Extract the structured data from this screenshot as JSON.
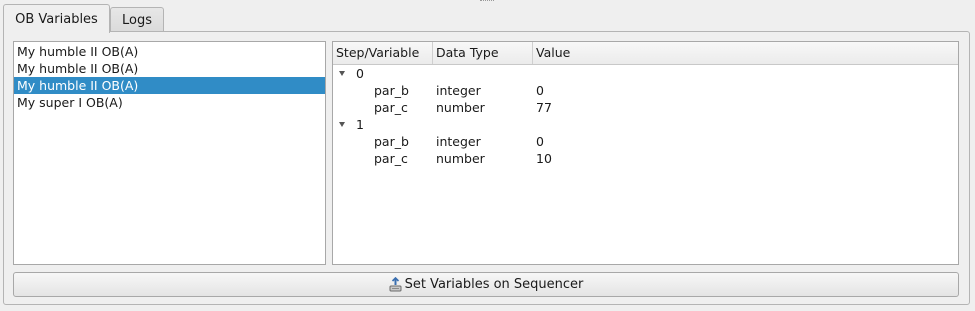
{
  "tabs": [
    {
      "label": "OB Variables",
      "active": true
    },
    {
      "label": "Logs",
      "active": false
    }
  ],
  "ob_list": {
    "items": [
      {
        "label": "My humble II OB(A)",
        "selected": false
      },
      {
        "label": "My humble II OB(A)",
        "selected": false
      },
      {
        "label": "My humble II OB(A)",
        "selected": true
      },
      {
        "label": "My super I OB(A)",
        "selected": false
      }
    ]
  },
  "variables_tree": {
    "columns": [
      "Step/Variable",
      "Data Type",
      "Value"
    ],
    "steps": [
      {
        "step": "0",
        "expanded": true,
        "variables": [
          {
            "name": "par_b",
            "type": "integer",
            "value": "0"
          },
          {
            "name": "par_c",
            "type": "number",
            "value": "77"
          }
        ]
      },
      {
        "step": "1",
        "expanded": true,
        "variables": [
          {
            "name": "par_b",
            "type": "integer",
            "value": "0"
          },
          {
            "name": "par_c",
            "type": "number",
            "value": "10"
          }
        ]
      }
    ]
  },
  "actions": {
    "set_variables_label": "Set Variables on Sequencer",
    "set_variables_icon": "upload-to-sequencer-icon"
  },
  "colors": {
    "selection": "#308cc6",
    "background": "#efefef"
  }
}
